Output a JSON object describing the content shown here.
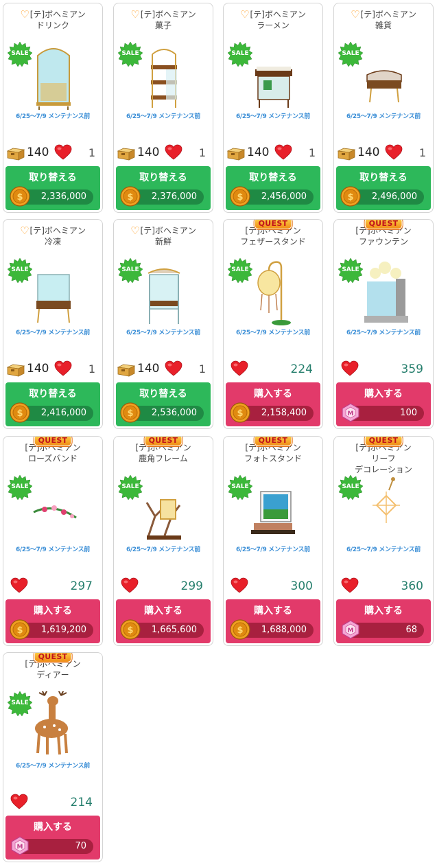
{
  "page": {
    "period_text": "6/25〜7/9 メンテナンス前",
    "sale_label": "SALE",
    "quest_label": "QUEST",
    "colors": {
      "exchange_button": "#2db85a",
      "buy_button": "#e23a6a",
      "sale_badge": "#3cb83a",
      "quest_badge": "#f5a21a"
    }
  },
  "items": [
    {
      "line1": "[テ]ボヘミアン",
      "line2": "ドリンク",
      "fav": true,
      "quest": false,
      "image": "glass-drink-cabinet",
      "box_count": "140",
      "heart_count": "1",
      "button": "取り替える",
      "button_type": "exchange",
      "currency": "coin",
      "price": "2,336,000"
    },
    {
      "line1": "[テ]ボヘミアン",
      "line2": "菓子",
      "fav": true,
      "quest": false,
      "image": "wooden-sweets-shelf",
      "box_count": "140",
      "heart_count": "1",
      "button": "取り替える",
      "button_type": "exchange",
      "currency": "coin",
      "price": "2,376,000"
    },
    {
      "line1": "[テ]ボヘミアン",
      "line2": "ラーメン",
      "fav": true,
      "quest": false,
      "image": "ramen-counter",
      "box_count": "140",
      "heart_count": "1",
      "button": "取り替える",
      "button_type": "exchange",
      "currency": "coin",
      "price": "2,456,000"
    },
    {
      "line1": "[テ]ボヘミアン",
      "line2": "雑貨",
      "fav": true,
      "quest": false,
      "image": "general-goods-table",
      "box_count": "140",
      "heart_count": "1",
      "button": "取り替える",
      "button_type": "exchange",
      "currency": "coin",
      "price": "2,496,000"
    },
    {
      "line1": "[テ]ボヘミアン",
      "line2": "冷凍",
      "fav": true,
      "quest": false,
      "image": "glass-freezer-case",
      "box_count": "140",
      "heart_count": "1",
      "button": "取り替える",
      "button_type": "exchange",
      "currency": "coin",
      "price": "2,416,000"
    },
    {
      "line1": "[テ]ボヘミアン",
      "line2": "新鮮",
      "fav": true,
      "quest": false,
      "image": "fresh-display-case",
      "box_count": "140",
      "heart_count": "1",
      "button": "取り替える",
      "button_type": "exchange",
      "currency": "coin",
      "price": "2,536,000"
    },
    {
      "line1": "[テ]ボヘミアン",
      "line2": "フェザースタンド",
      "fav": false,
      "quest": true,
      "image": "feather-lamp-stand",
      "box_count": "",
      "heart_count": "224",
      "button": "購入する",
      "button_type": "buy",
      "currency": "coin",
      "price": "2,158,400"
    },
    {
      "line1": "[テ]ボヘミアン",
      "line2": "ファウンテン",
      "fav": false,
      "quest": true,
      "image": "flower-fountain",
      "box_count": "",
      "heart_count": "359",
      "button": "購入する",
      "button_type": "buy",
      "currency": "gem",
      "price": "100"
    },
    {
      "line1": "[テ]ボヘミアン",
      "line2": "ローズバンド",
      "fav": false,
      "quest": true,
      "image": "rose-hairband",
      "box_count": "",
      "heart_count": "297",
      "button": "購入する",
      "button_type": "buy",
      "currency": "coin",
      "price": "1,619,200"
    },
    {
      "line1": "[テ]ボヘミアン",
      "line2": "鹿角フレーム",
      "fav": false,
      "quest": true,
      "image": "antler-frame",
      "box_count": "",
      "heart_count": "299",
      "button": "購入する",
      "button_type": "buy",
      "currency": "coin",
      "price": "1,665,600"
    },
    {
      "line1": "[テ]ボヘミアン",
      "line2": "フォトスタンド",
      "fav": false,
      "quest": true,
      "image": "photo-stand",
      "box_count": "",
      "heart_count": "300",
      "button": "購入する",
      "button_type": "buy",
      "currency": "coin",
      "price": "1,688,000"
    },
    {
      "line1": "[テ]ボヘミアン",
      "line2": "リーフ",
      "line3": "デコレーション",
      "fav": false,
      "quest": true,
      "image": "leaf-decoration",
      "box_count": "",
      "heart_count": "360",
      "button": "購入する",
      "button_type": "buy",
      "currency": "gem",
      "price": "68"
    },
    {
      "line1": "[テ]ボヘミアン",
      "line2": "ディアー",
      "fav": false,
      "quest": true,
      "image": "deer-figure",
      "box_count": "",
      "heart_count": "214",
      "button": "購入する",
      "button_type": "buy",
      "currency": "gem",
      "price": "70"
    }
  ]
}
